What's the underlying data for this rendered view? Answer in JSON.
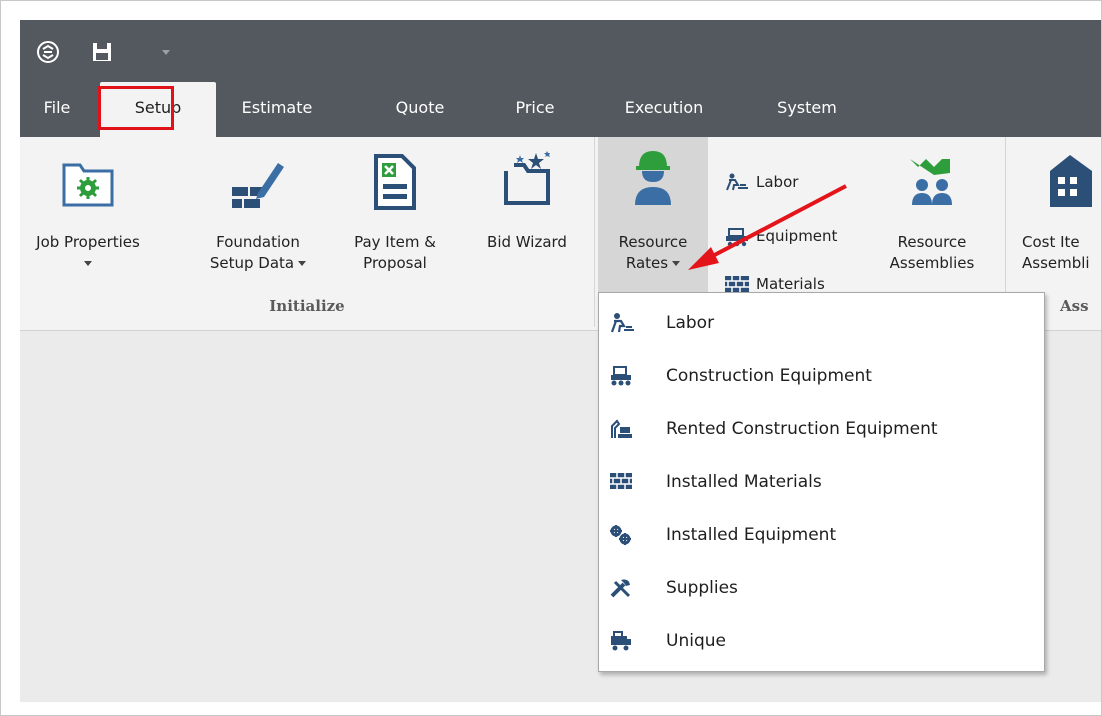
{
  "qat": {
    "logo_icon": "app-logo-icon",
    "save_icon": "save-icon",
    "menu_icon": "dropdown-icon"
  },
  "tabs": [
    {
      "label": "File"
    },
    {
      "label": "Setup"
    },
    {
      "label": "Estimate"
    },
    {
      "label": "Quote"
    },
    {
      "label": "Price"
    },
    {
      "label": "Execution"
    },
    {
      "label": "System"
    }
  ],
  "ribbon": {
    "job_properties": {
      "label": "Job Properties",
      "icon": "folder-gear-icon"
    },
    "foundation_setup": {
      "line1": "Foundation",
      "line2": "Setup Data",
      "icon": "pencil-bricks-icon"
    },
    "pay_item": {
      "line1": "Pay Item &",
      "line2": "Proposal",
      "icon": "excel-document-icon"
    },
    "bid_wizard": {
      "label": "Bid Wizard",
      "icon": "wizard-folder-icon"
    },
    "resource_rates": {
      "line1": "Resource",
      "line2": "Rates",
      "icon": "worker-icon"
    },
    "labor": {
      "label": "Labor",
      "icon": "labor-icon"
    },
    "equipment": {
      "label": "Equipment",
      "icon": "equipment-icon"
    },
    "materials": {
      "label": "Materials",
      "icon": "materials-icon"
    },
    "resource_assemblies": {
      "line1": "Resource",
      "line2": "Assemblies",
      "icon": "assembly-icon"
    },
    "cost_item": {
      "line1": "Cost Ite",
      "line2": "Assembli",
      "icon": "building-icon"
    },
    "groups": {
      "initialize": "Initialize",
      "assemblies": "Ass"
    }
  },
  "dropdown": {
    "items": [
      {
        "label": "Labor",
        "icon": "labor-icon"
      },
      {
        "label": "Construction Equipment",
        "icon": "construction-equipment-icon"
      },
      {
        "label": "Rented Construction Equipment",
        "icon": "rented-equipment-icon"
      },
      {
        "label": "Installed Materials",
        "icon": "installed-materials-icon"
      },
      {
        "label": "Installed Equipment",
        "icon": "installed-equipment-icon"
      },
      {
        "label": "Supplies",
        "icon": "supplies-icon"
      },
      {
        "label": "Unique",
        "icon": "unique-icon"
      }
    ]
  },
  "colors": {
    "titlebar": "#53595e",
    "highlight": "#e01218",
    "accent_green": "#2e9e3c",
    "accent_blue": "#3a6ea5"
  }
}
